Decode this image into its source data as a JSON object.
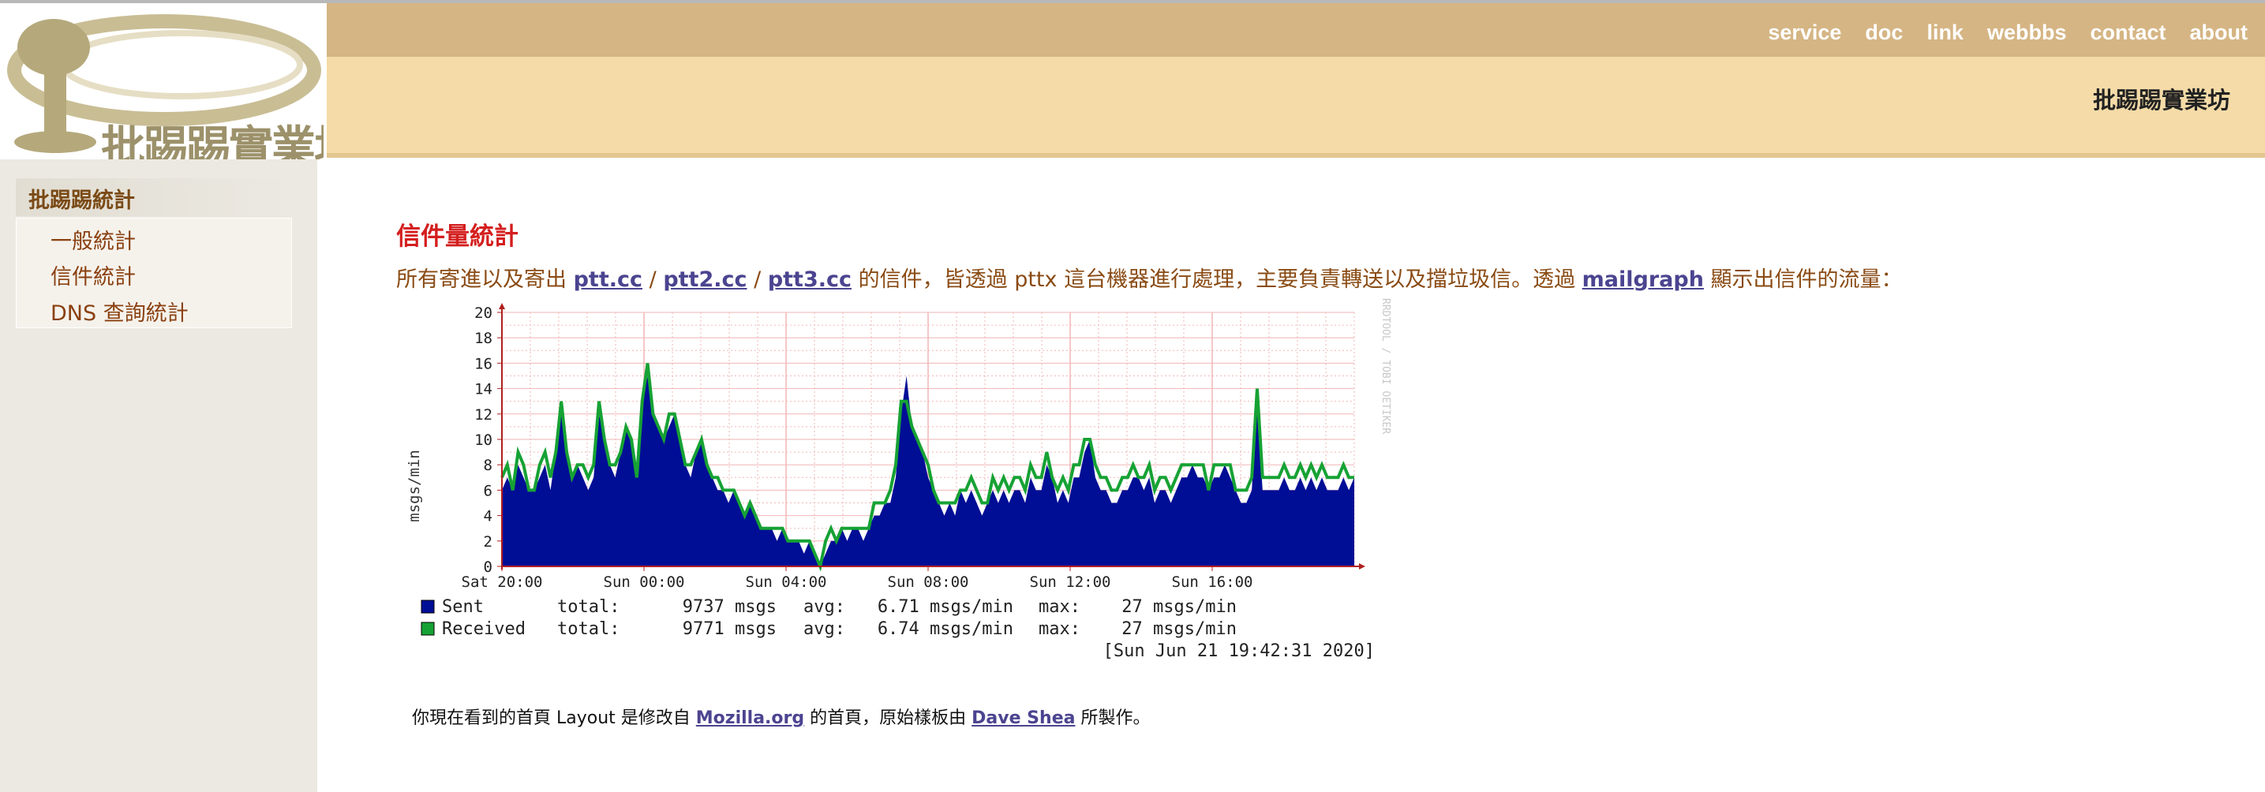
{
  "logo": {
    "text": "批踢踢實業坊"
  },
  "nav": [
    "service",
    "doc",
    "link",
    "webbbs",
    "contact",
    "about"
  ],
  "site_name": "批踢踢實業坊",
  "sidebar": {
    "heading": "批踢踢統計",
    "items": [
      {
        "label": "一般統計"
      },
      {
        "label": "信件統計"
      },
      {
        "label": "DNS 查詢統計"
      }
    ]
  },
  "main": {
    "title": "信件量統計",
    "desc": {
      "prefix": "所有寄進以及寄出",
      "link1": "ptt.cc",
      "sep1": "/",
      "link2": "ptt2.cc",
      "sep2": "/",
      "link3": "ptt3.cc",
      "middle": "的信件，皆透過 pttx 這台機器進行處理，主要負責轉送以及擋垃圾信。透過",
      "link4": "mailgraph",
      "suffix": "顯示出信件的流量："
    }
  },
  "chart_data": {
    "type": "area",
    "ylabel": "msgs/min",
    "watermark": "RRDTOOL / TOBI OETIKER",
    "ylim": [
      0,
      20
    ],
    "yticks": [
      0,
      2,
      4,
      6,
      8,
      10,
      12,
      14,
      16,
      18,
      20
    ],
    "xticks": [
      "Sat 20:00",
      "Sun 00:00",
      "Sun 04:00",
      "Sun 08:00",
      "Sun 12:00",
      "Sun 16:00"
    ],
    "colors": {
      "sent": "#000e96",
      "received": "#16a234",
      "grid": "#f2b6b6",
      "axis": "#b02020"
    },
    "series": [
      {
        "name": "Sent",
        "values": [
          6,
          7,
          6,
          8,
          7,
          6,
          6,
          7,
          8,
          6,
          9,
          12,
          9,
          7,
          8,
          7,
          6,
          7,
          12,
          10,
          8,
          7,
          9,
          11,
          10,
          7,
          13,
          15,
          12,
          11,
          10,
          11,
          12,
          10,
          8,
          7,
          9,
          10,
          8,
          7,
          6,
          6,
          5,
          6,
          5,
          4,
          5,
          4,
          3,
          3,
          3,
          2,
          3,
          2,
          2,
          2,
          1,
          2,
          1,
          0,
          1,
          2,
          2,
          3,
          2,
          3,
          3,
          2,
          3,
          4,
          4,
          5,
          5,
          7,
          12,
          15,
          11,
          10,
          9,
          7,
          6,
          5,
          4,
          5,
          4,
          6,
          5,
          6,
          5,
          4,
          5,
          6,
          5,
          6,
          5,
          6,
          6,
          5,
          7,
          6,
          6,
          8,
          7,
          5,
          6,
          5,
          7,
          7,
          9,
          10,
          7,
          6,
          6,
          5,
          5,
          6,
          6,
          7,
          7,
          6,
          7,
          5,
          6,
          6,
          5,
          6,
          7,
          7,
          8,
          7,
          7,
          6,
          7,
          7,
          8,
          7,
          6,
          5,
          5,
          6,
          13,
          6,
          6,
          6,
          6,
          7,
          6,
          6,
          7,
          6,
          7,
          6,
          7,
          6,
          6,
          6,
          7,
          6,
          7
        ],
        "total": "9737 msgs",
        "avg": "6.71 msgs/min",
        "max": "27 msgs/min"
      },
      {
        "name": "Received",
        "values": [
          7,
          8,
          6,
          9,
          8,
          6,
          6,
          8,
          9,
          7,
          9,
          13,
          9,
          7,
          8,
          8,
          7,
          8,
          13,
          10,
          8,
          8,
          9,
          11,
          10,
          7,
          13,
          16,
          12,
          11,
          10,
          12,
          12,
          10,
          8,
          8,
          9,
          10,
          8,
          7,
          7,
          6,
          6,
          6,
          5,
          4,
          5,
          4,
          3,
          3,
          3,
          3,
          3,
          2,
          2,
          2,
          2,
          2,
          1,
          0,
          2,
          3,
          2,
          3,
          3,
          3,
          3,
          3,
          3,
          5,
          5,
          5,
          6,
          8,
          13,
          13,
          11,
          10,
          9,
          8,
          6,
          5,
          5,
          5,
          5,
          6,
          6,
          7,
          6,
          5,
          5,
          7,
          6,
          7,
          6,
          7,
          7,
          6,
          8,
          7,
          7,
          9,
          7,
          6,
          7,
          6,
          8,
          8,
          10,
          10,
          8,
          7,
          7,
          6,
          6,
          7,
          7,
          8,
          7,
          7,
          8,
          6,
          7,
          7,
          6,
          7,
          8,
          8,
          8,
          8,
          8,
          6,
          8,
          8,
          8,
          8,
          6,
          6,
          6,
          7,
          14,
          7,
          7,
          7,
          7,
          8,
          7,
          7,
          8,
          7,
          8,
          7,
          8,
          7,
          7,
          7,
          8,
          7,
          7
        ],
        "total": "9771 msgs",
        "avg": "6.74 msgs/min",
        "max": "27 msgs/min"
      }
    ],
    "legend": {
      "sent_label": "Sent",
      "received_label": "Received",
      "total_label": "total:",
      "avg_label": "avg:",
      "max_label": "max:"
    },
    "timestamp": "[Sun Jun 21 19:42:31 2020]"
  },
  "footer": {
    "prefix": "你現在看到的首頁 Layout 是修改自",
    "link1": "Mozilla.org",
    "middle": "的首頁，原始樣板由",
    "link2": "Dave Shea",
    "suffix": "所製作。"
  }
}
